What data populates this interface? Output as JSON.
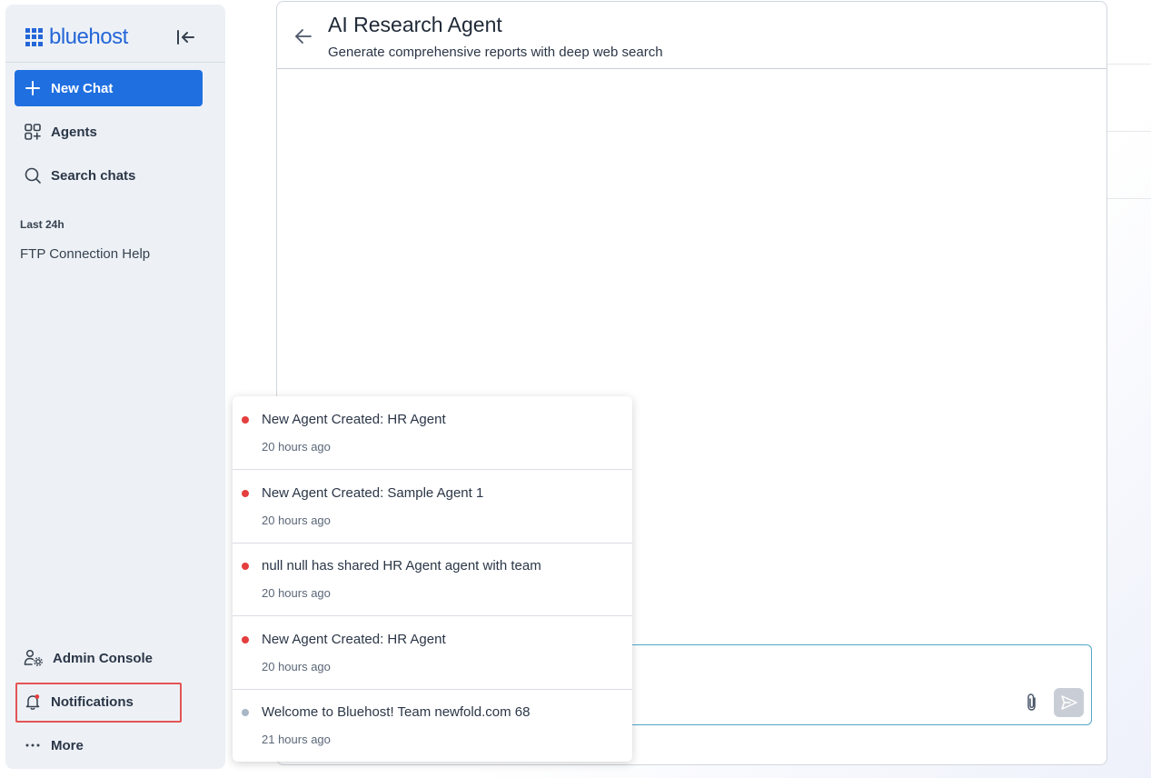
{
  "brand": {
    "name": "bluehost",
    "color": "#2466d8"
  },
  "sidebar": {
    "new_chat_label": "New Chat",
    "items": [
      {
        "label": "Agents",
        "icon": "agents-icon"
      },
      {
        "label": "Search chats",
        "icon": "search-icon"
      }
    ],
    "section_label": "Last 24h",
    "history": [
      "FTP Connection Help"
    ],
    "bottom_items": [
      {
        "label": "Admin Console",
        "icon": "admin-users-gear-icon"
      },
      {
        "label": "Notifications",
        "icon": "bell-icon"
      },
      {
        "label": "More",
        "icon": "more-dots-icon"
      }
    ]
  },
  "header": {
    "title": "AI Research Agent",
    "subtitle": "Generate comprehensive reports with deep web search"
  },
  "notifications": [
    {
      "text": "New Agent Created: HR Agent",
      "time": "20 hours ago",
      "unread": true
    },
    {
      "text": "New Agent Created: Sample Agent 1",
      "time": "20 hours ago",
      "unread": true
    },
    {
      "text": "null null has shared HR Agent agent with team",
      "time": "20 hours ago",
      "unread": true
    },
    {
      "text": "New Agent Created: HR Agent",
      "time": "20 hours ago",
      "unread": true
    },
    {
      "text": "Welcome to Bluehost! Team newfold.com 68",
      "time": "21 hours ago",
      "unread": false
    }
  ],
  "colors": {
    "accent": "#1f6fe0",
    "unread_dot": "#e53e3e",
    "read_dot": "#a9b6c6",
    "highlight": "#e35454"
  }
}
